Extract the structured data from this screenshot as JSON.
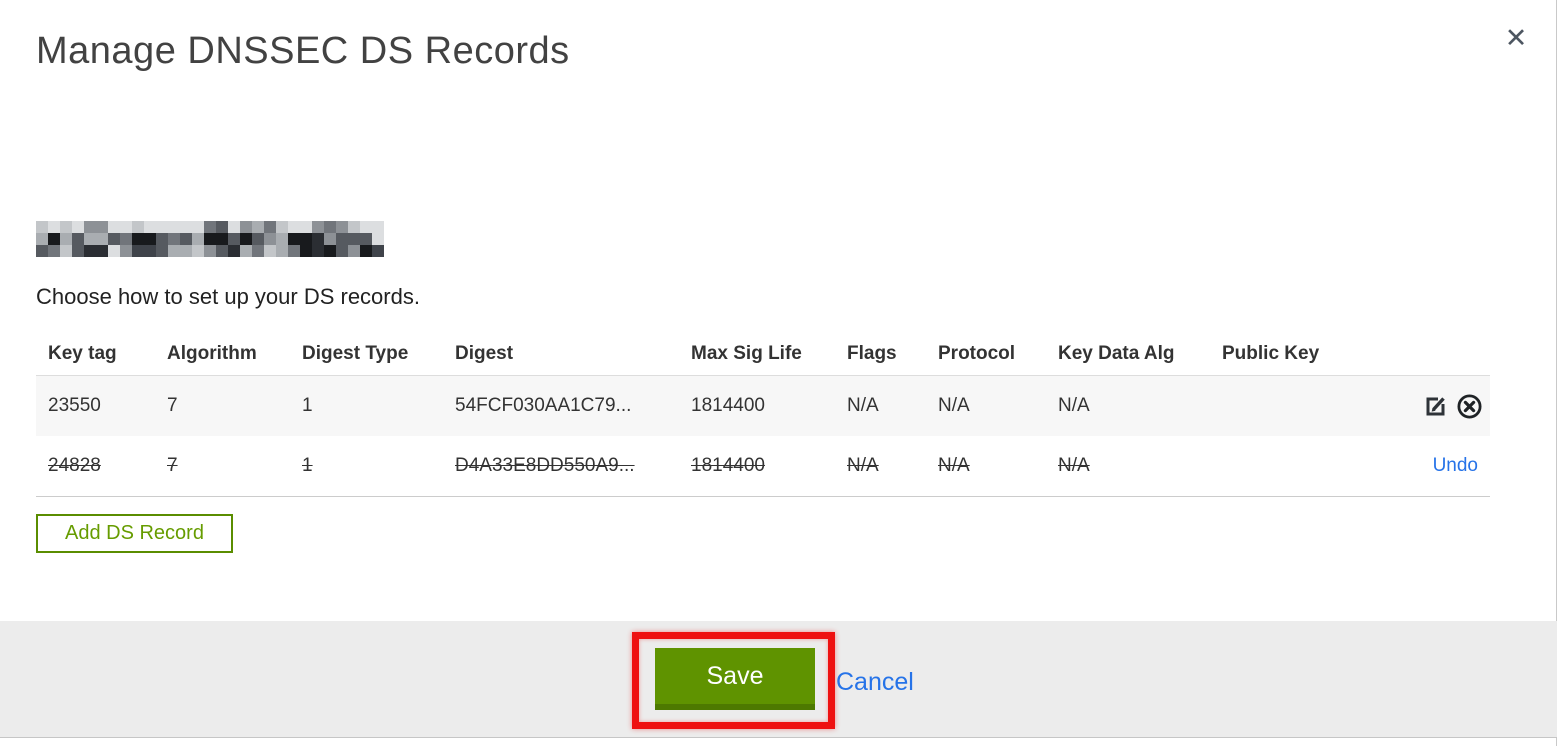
{
  "dialog": {
    "title": "Manage DNSSEC DS Records",
    "close_label": "✕",
    "instruction": "Choose how to set up your DS records.",
    "domain": {
      "redacted": true
    }
  },
  "table": {
    "columns": [
      "Key tag",
      "Algorithm",
      "Digest Type",
      "Digest",
      "Max Sig Life",
      "Flags",
      "Protocol",
      "Key Data Alg",
      "Public Key"
    ],
    "rows": [
      {
        "key_tag": "23550",
        "algorithm": "7",
        "digest_type": "1",
        "digest": "54FCF030AA1C79...",
        "max_sig_life": "1814400",
        "flags": "N/A",
        "protocol": "N/A",
        "key_data_alg": "N/A",
        "public_key": "",
        "deleted": false,
        "actions": [
          "edit",
          "delete"
        ]
      },
      {
        "key_tag": "24828",
        "algorithm": "7",
        "digest_type": "1",
        "digest": "D4A33E8DD550A9...",
        "max_sig_life": "1814400",
        "flags": "N/A",
        "protocol": "N/A",
        "key_data_alg": "N/A",
        "public_key": "",
        "deleted": true,
        "undo_label": "Undo"
      }
    ]
  },
  "buttons": {
    "add_record": "Add DS Record",
    "save": "Save",
    "cancel": "Cancel"
  },
  "colors": {
    "accent_green": "#5f9300",
    "accent_green_dark": "#4d7900",
    "add_button_green": "#5a8d00",
    "link_blue": "#2673e8",
    "annotation_red": "#ee1111",
    "footer_bg": "#ececec",
    "row_alt_bg": "#f7f7f7",
    "text_dark": "#333333"
  }
}
